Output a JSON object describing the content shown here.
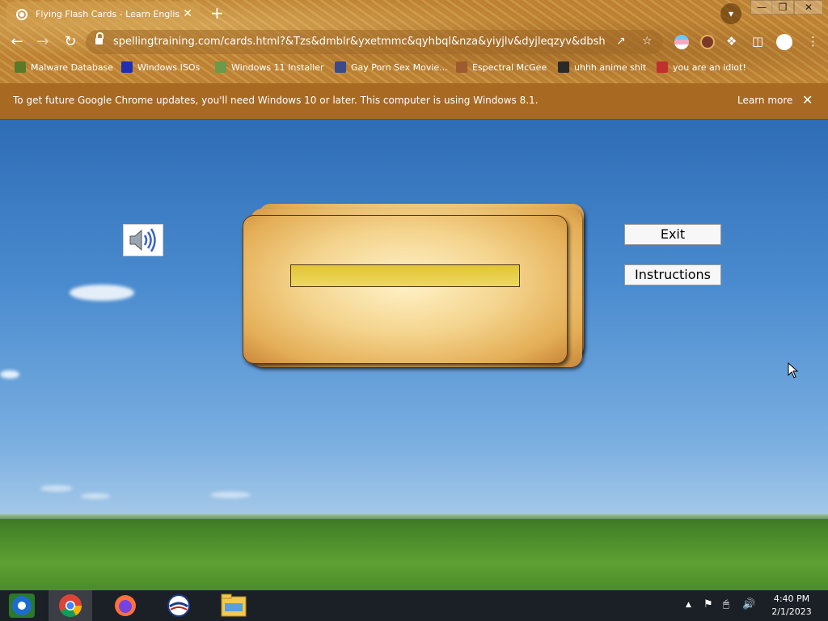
{
  "browser": {
    "tab_title": "Flying Flash Cards - Learn English",
    "new_tab_symbol": "+",
    "tab_close_symbol": "✕",
    "url": "spellingtraining.com/cards.html?&Tzs&dmblr&yxetmmc&qyhbql&nza&yiyjlv&dyjleqzyv&dbsh...",
    "window_controls": [
      "—",
      "❐",
      "✕"
    ]
  },
  "bookmarks": [
    {
      "label": "Malware Database",
      "icon": "pixel-icon",
      "color": "#5a7a2a"
    },
    {
      "label": "Windows ISOs",
      "icon": "x-icon",
      "color": "#1e2fb0"
    },
    {
      "label": "Windows 11 Installer",
      "icon": "image-icon",
      "color": "#6a9a4a"
    },
    {
      "label": "Gay Porn Sex Movie...",
      "icon": "globe-icon",
      "color": "#3a4a8a"
    },
    {
      "label": "Espectral McGee",
      "icon": "avatar-icon",
      "color": "#a05a30"
    },
    {
      "label": "uhhh anime shit",
      "icon": "anime-icon",
      "color": "#2a2a2a"
    },
    {
      "label": "you are an idiot!",
      "icon": "flag-icon",
      "color": "#c03030"
    }
  ],
  "infobar": {
    "message": "To get future Google Chrome updates, you'll need Windows 10 or later. This computer is using Windows 8.1.",
    "learn_more": "Learn more",
    "close_symbol": "✕"
  },
  "page": {
    "exit_label": "Exit",
    "instructions_label": "Instructions",
    "answer_value": ""
  },
  "taskbar": {
    "time": "4:40 PM",
    "date": "2/1/2023",
    "apps": [
      "windows-media-center-icon",
      "chrome-icon",
      "firefox-icon",
      "obama-logo-icon",
      "file-explorer-icon"
    ]
  }
}
